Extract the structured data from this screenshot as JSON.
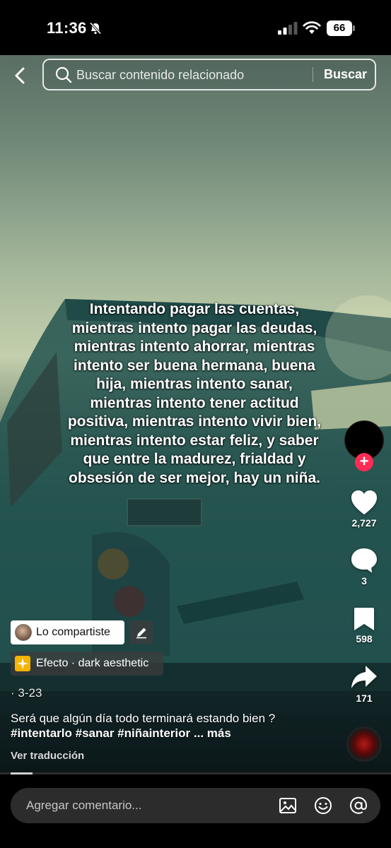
{
  "status_bar": {
    "time": "11:36",
    "battery": "66"
  },
  "search": {
    "placeholder": "Buscar contenido relacionado",
    "submit_label": "Buscar"
  },
  "overlay_text": "Intentando pagar las cuentas, mientras intento pagar las deudas, mientras intento ahorrar, mientras intento ser buena hermana, buena hija, mientras intento sanar, mientras intento tener actitud positiva, mientras intento vivir bien, mientras intento estar feliz, y saber que entre la madurez, frialdad y obsesión de ser mejor, hay un niña.",
  "actions": {
    "likes": "2,727",
    "comments": "3",
    "saves": "598",
    "shares": "171"
  },
  "post": {
    "shared_label": "Lo compartiste",
    "effect_label": "Efecto · dark aesthetic",
    "date": "· 3-23",
    "caption_text": "Será que algún día todo terminará estando bien ?",
    "caption_tags": "#intentarlo #sanar #niñainterior",
    "more_label": "... más",
    "translate_label": "Ver traducción"
  },
  "playback": {
    "progress_fraction": 0.06
  },
  "comment_bar": {
    "placeholder": "Agregar comentario..."
  },
  "colors": {
    "accent": "#fe2c55",
    "effect_icon": "#f5b400"
  },
  "icons": [
    "bell-slash-icon",
    "signal-icon",
    "wifi-icon",
    "back-icon",
    "search-icon",
    "plus-icon",
    "heart-icon",
    "comment-icon",
    "bookmark-icon",
    "share-icon",
    "pencil-icon",
    "sparkle-icon",
    "image-icon",
    "emoji-icon",
    "at-icon"
  ]
}
